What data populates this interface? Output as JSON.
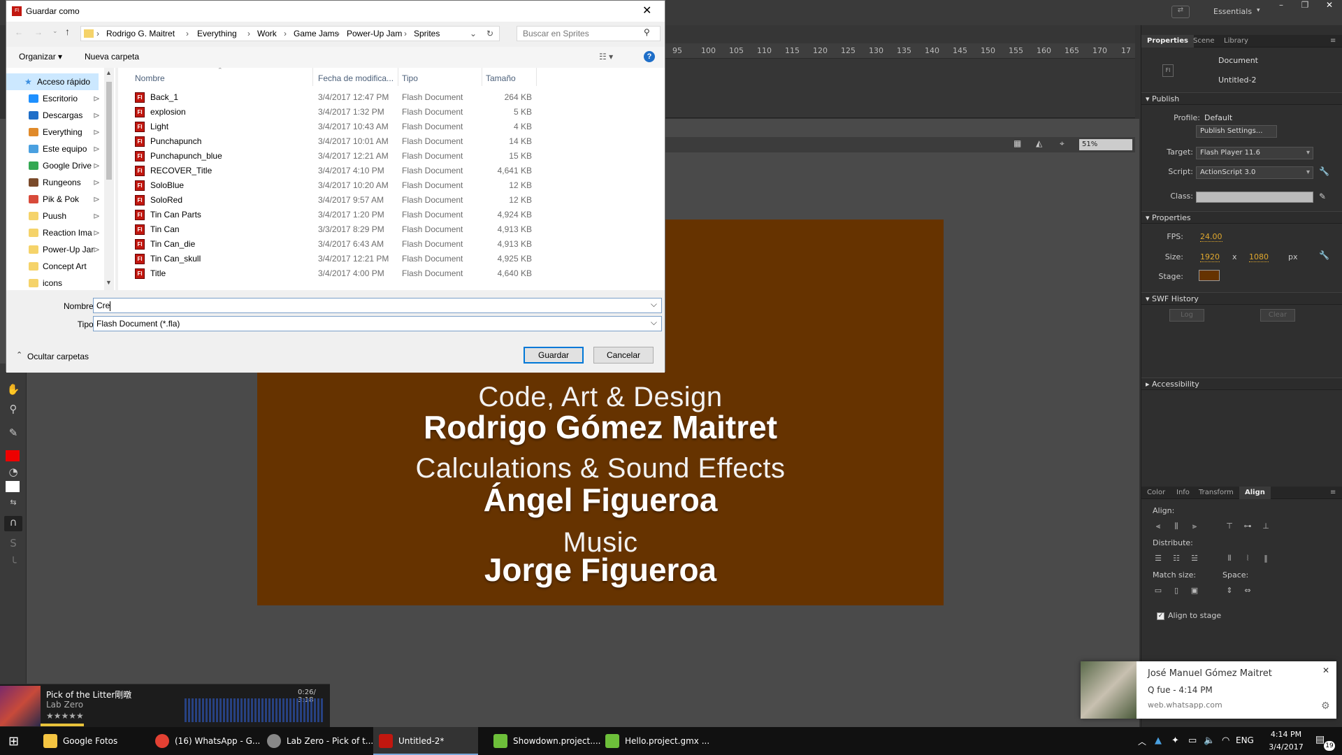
{
  "workspace": {
    "workspace_label": "Essentials",
    "ruler_ticks": [
      "95",
      "100",
      "105",
      "110",
      "115",
      "120",
      "125",
      "130",
      "135",
      "140",
      "145",
      "150",
      "155",
      "160",
      "165",
      "170",
      "17"
    ],
    "zoom": "51%"
  },
  "stage": {
    "background": "#663300",
    "lines": [
      {
        "role": "Code, Art & Design",
        "person": "Rodrigo Gómez Maitret"
      },
      {
        "role": "Calculations & Sound Effects",
        "person": "Ángel Figueroa"
      },
      {
        "role": "Music",
        "person": "Jorge Figueroa"
      }
    ]
  },
  "right_panel": {
    "tabs": [
      "Properties",
      "Scene",
      "Library"
    ],
    "doc_type": "Document",
    "doc_name": "Untitled-2",
    "publish": {
      "header": "Publish",
      "profile_label": "Profile:",
      "profile_value": "Default",
      "publish_settings_button": "Publish Settings...",
      "target_label": "Target:",
      "target_value": "Flash Player 11.6",
      "script_label": "Script:",
      "script_value": "ActionScript 3.0",
      "class_label": "Class:"
    },
    "properties": {
      "header": "Properties",
      "fps_label": "FPS:",
      "fps_value": "24.00",
      "size_label": "Size:",
      "width": "1920",
      "x_sep": "x",
      "height": "1080",
      "unit": "px",
      "stage_label": "Stage:",
      "stage_color": "#663300"
    },
    "swf_history": {
      "header": "SWF History",
      "log_button": "Log",
      "clear_button": "Clear"
    },
    "accessibility": {
      "header": "Accessibility"
    },
    "align_tabs": [
      "Color",
      "Info",
      "Transform",
      "Align"
    ],
    "align": {
      "align_label": "Align:",
      "distribute_label": "Distribute:",
      "match_size_label": "Match size:",
      "space_label": "Space:",
      "align_to_stage": "Align to stage"
    }
  },
  "dialog": {
    "title": "Guardar como",
    "breadcrumbs": [
      "Rodrigo G. Maitret",
      "Everything",
      "Work",
      "Game Jams",
      "Power-Up Jam",
      "Sprites"
    ],
    "search_placeholder": "Buscar en Sprites",
    "organize": "Organizar",
    "new_folder": "Nueva carpeta",
    "nav": [
      {
        "label": "Acceso rápido",
        "color": "#3b8ee0"
      },
      {
        "label": "Escritorio",
        "color": "#1e90ff"
      },
      {
        "label": "Descargas",
        "color": "#1e6ec8"
      },
      {
        "label": "Everything",
        "color": "#e08a2a"
      },
      {
        "label": "Este equipo",
        "color": "#4aa0e0"
      },
      {
        "label": "Google Drive",
        "color": "#34a853"
      },
      {
        "label": "Rungeons",
        "color": "#7a4a2a"
      },
      {
        "label": "Pik & Pok",
        "color": "#d84a3a"
      },
      {
        "label": "Puush",
        "color": "#f5d36a"
      },
      {
        "label": "Reaction Ima",
        "color": "#f5d36a"
      },
      {
        "label": "Power-Up Jar",
        "color": "#f5d36a"
      },
      {
        "label": "Concept Art",
        "color": "#f5d36a"
      },
      {
        "label": "icons",
        "color": "#f5d36a"
      }
    ],
    "columns": [
      "Nombre",
      "Fecha de modifica...",
      "Tipo",
      "Tamaño"
    ],
    "files": [
      {
        "name": "Back_1",
        "date": "3/4/2017 12:47 PM",
        "type": "Flash Document",
        "size": "264 KB"
      },
      {
        "name": "explosion",
        "date": "3/4/2017 1:32 PM",
        "type": "Flash Document",
        "size": "5 KB"
      },
      {
        "name": "Light",
        "date": "3/4/2017 10:43 AM",
        "type": "Flash Document",
        "size": "4 KB"
      },
      {
        "name": "Punchapunch",
        "date": "3/4/2017 10:01 AM",
        "type": "Flash Document",
        "size": "14 KB"
      },
      {
        "name": "Punchapunch_blue",
        "date": "3/4/2017 12:21 AM",
        "type": "Flash Document",
        "size": "15 KB"
      },
      {
        "name": "RECOVER_Title",
        "date": "3/4/2017 4:10 PM",
        "type": "Flash Document",
        "size": "4,641 KB"
      },
      {
        "name": "SoloBlue",
        "date": "3/4/2017 10:20 AM",
        "type": "Flash Document",
        "size": "12 KB"
      },
      {
        "name": "SoloRed",
        "date": "3/4/2017 9:57 AM",
        "type": "Flash Document",
        "size": "12 KB"
      },
      {
        "name": "Tin Can Parts",
        "date": "3/4/2017 1:20 PM",
        "type": "Flash Document",
        "size": "4,924 KB"
      },
      {
        "name": "Tin Can",
        "date": "3/3/2017 8:29 PM",
        "type": "Flash Document",
        "size": "4,913 KB"
      },
      {
        "name": "Tin Can_die",
        "date": "3/4/2017 6:43 AM",
        "type": "Flash Document",
        "size": "4,913 KB"
      },
      {
        "name": "Tin Can_skull",
        "date": "3/4/2017 12:21 PM",
        "type": "Flash Document",
        "size": "4,925 KB"
      },
      {
        "name": "Title",
        "date": "3/4/2017 4:00 PM",
        "type": "Flash Document",
        "size": "4,640 KB"
      }
    ],
    "name_label": "Nombre:",
    "name_value": "Cre",
    "type_label": "Tipo:",
    "type_value": "Flash Document (*.fla)",
    "hide_folders": "Ocultar carpetas",
    "save_button": "Guardar",
    "cancel_button": "Cancelar"
  },
  "player": {
    "track": "Pick of the Litter剛暾",
    "artist": "Lab Zero",
    "time": "0:26/ 3:18"
  },
  "notification": {
    "sender": "José Manuel Gómez Maitret",
    "message": "Q fue - 4:14 PM",
    "source": "web.whatsapp.com"
  },
  "taskbar": {
    "items": [
      {
        "label": "Google Fotos",
        "color": "#f5c542"
      },
      {
        "label": "(16) WhatsApp - G...",
        "color": "#e34133"
      },
      {
        "label": "Lab Zero - Pick of t...",
        "color": "#888888"
      },
      {
        "label": "Untitled-2*",
        "color": "#c1170f"
      },
      {
        "label": "Showdown.project....",
        "color": "#6dbf3a"
      },
      {
        "label": "Hello.project.gmx ...",
        "color": "#6dbf3a"
      }
    ],
    "lang": "ENG",
    "time": "4:14 PM",
    "date": "3/4/2017",
    "notif_count": "19"
  }
}
